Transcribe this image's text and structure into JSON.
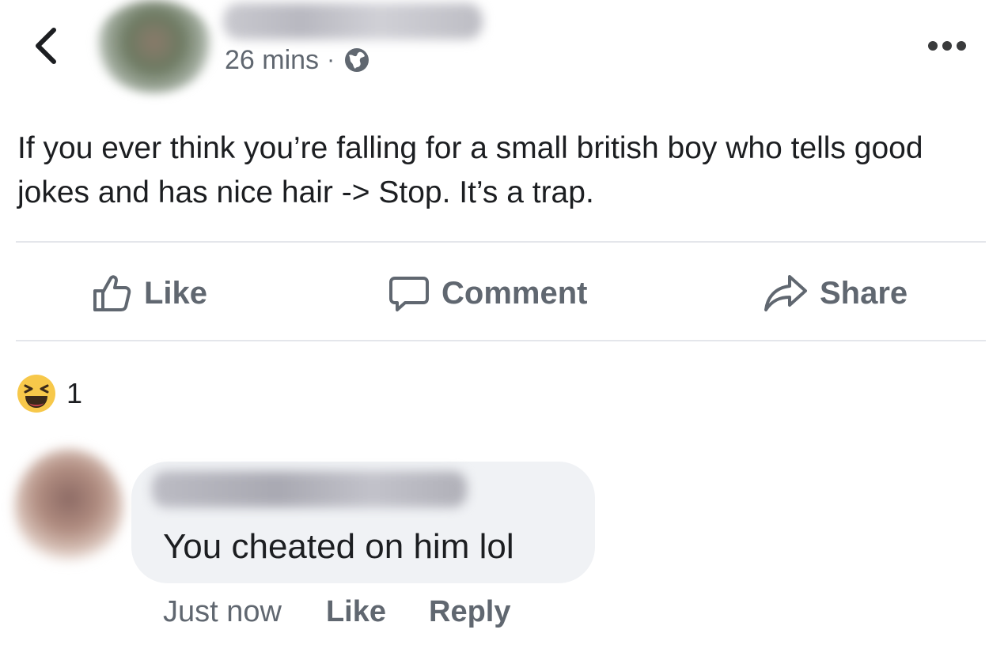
{
  "post": {
    "timestamp": "26 mins",
    "separator": "·",
    "text": "If you ever think you’re falling for a small british boy who tells good jokes and has nice hair -> Stop. It’s a trap."
  },
  "actions": {
    "like": "Like",
    "comment": "Comment",
    "share": "Share"
  },
  "reactions": {
    "count": "1",
    "type": "haha"
  },
  "comment": {
    "text": "You cheated on him lol",
    "time": "Just now",
    "like": "Like",
    "reply": "Reply"
  },
  "icons": {
    "back": "chevron-left-icon",
    "privacy": "globe-icon",
    "more": "more-options-icon",
    "like": "thumbs-up-icon",
    "comment": "comment-bubble-icon",
    "share": "share-arrow-icon",
    "reaction": "haha-emoji-icon"
  },
  "colors": {
    "secondary_text": "#606770",
    "divider": "#e4e6eb",
    "bubble": "#f0f2f5",
    "reaction_yellow": "#f7c84a"
  }
}
